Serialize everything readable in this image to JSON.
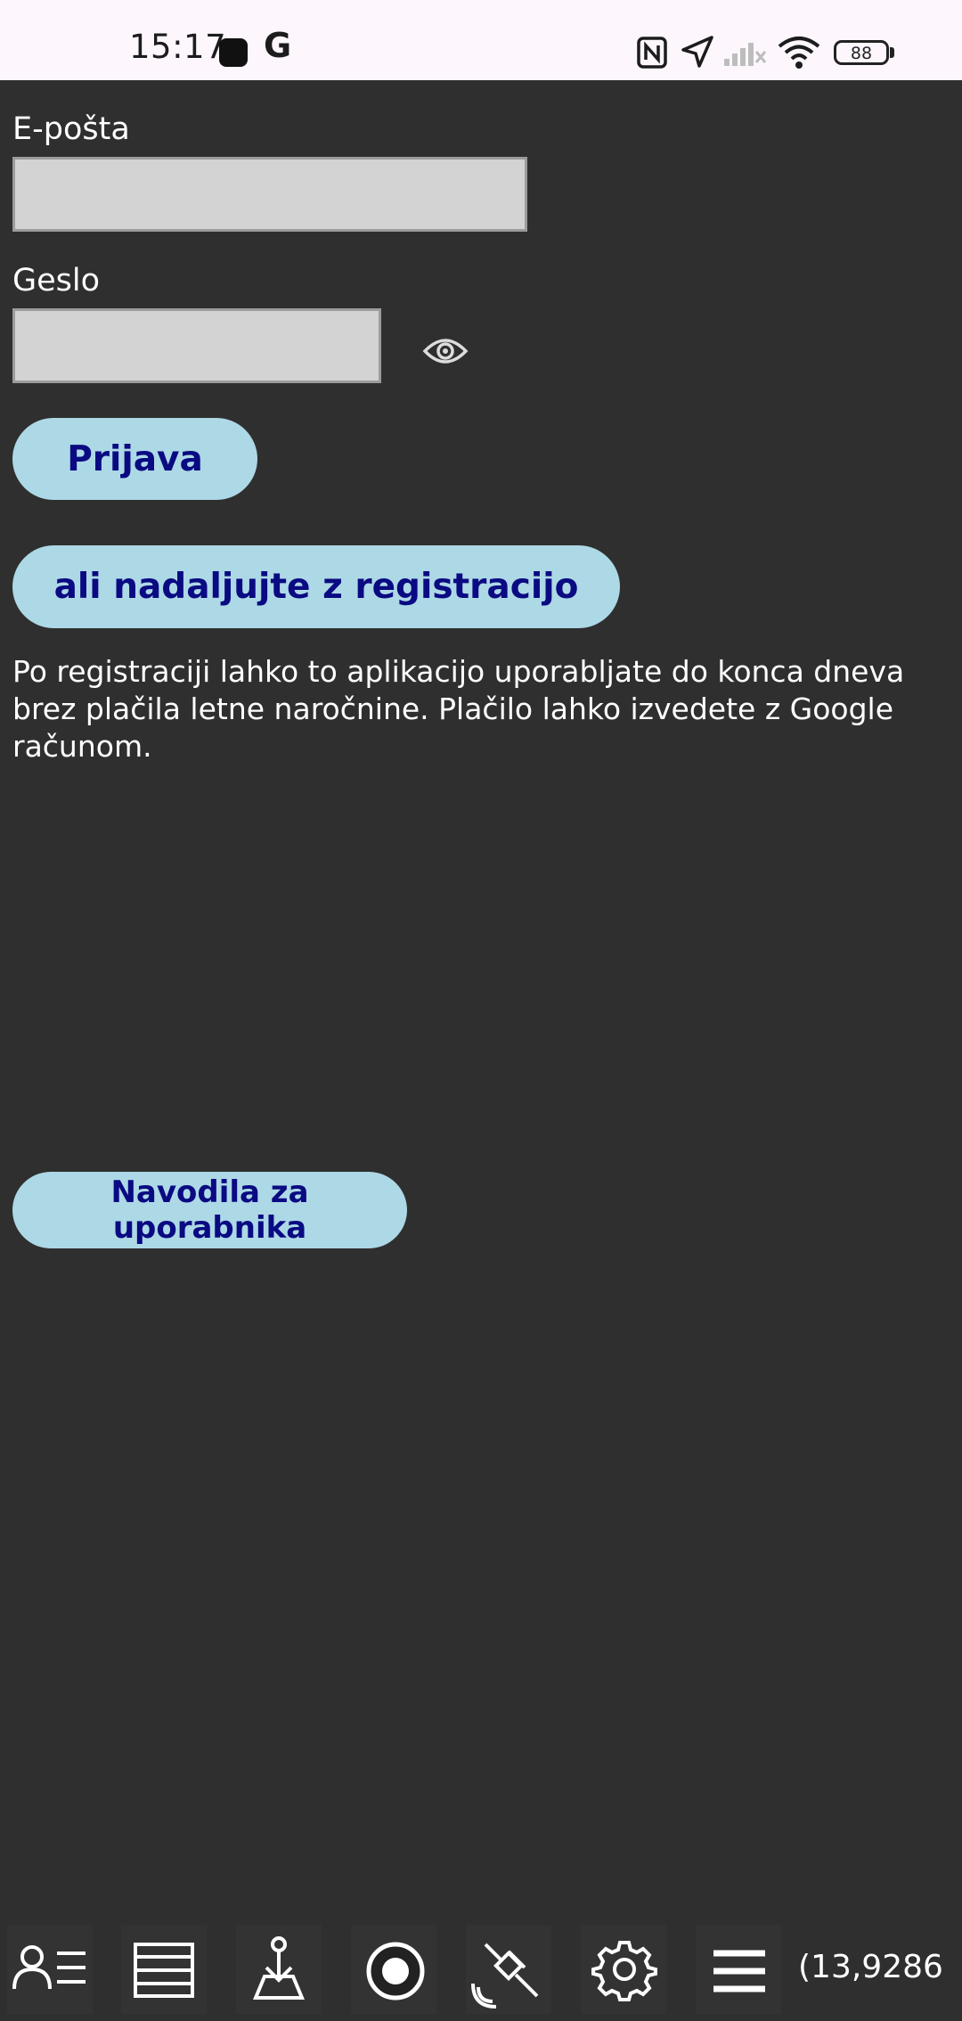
{
  "status_bar": {
    "time": "15:17",
    "notification_app": "G",
    "battery": "88"
  },
  "form": {
    "email_label": "E-pošta",
    "email_value": "",
    "password_label": "Geslo",
    "password_value": "",
    "login_button": "Prijava",
    "register_button": "ali nadaljujte z registracijo",
    "info_text": "Po registraciji lahko to aplikacijo uporabljate do konca dneva brez plačila letne naročnine. Plačilo lahko izvedete z Google računom.",
    "manual_button": "Navodila za uporabnika"
  },
  "toolbar": {
    "items": [
      "user-list-icon",
      "layers-icon",
      "survey-point-icon",
      "record-icon",
      "satellite-icon",
      "settings-icon",
      "menu-icon"
    ],
    "coordinate": "(13,9286"
  },
  "colors": {
    "background": "#2f2f2f",
    "button_bg": "#add8e6",
    "button_text": "#0a0a82",
    "input_bg": "#d3d3d3"
  }
}
